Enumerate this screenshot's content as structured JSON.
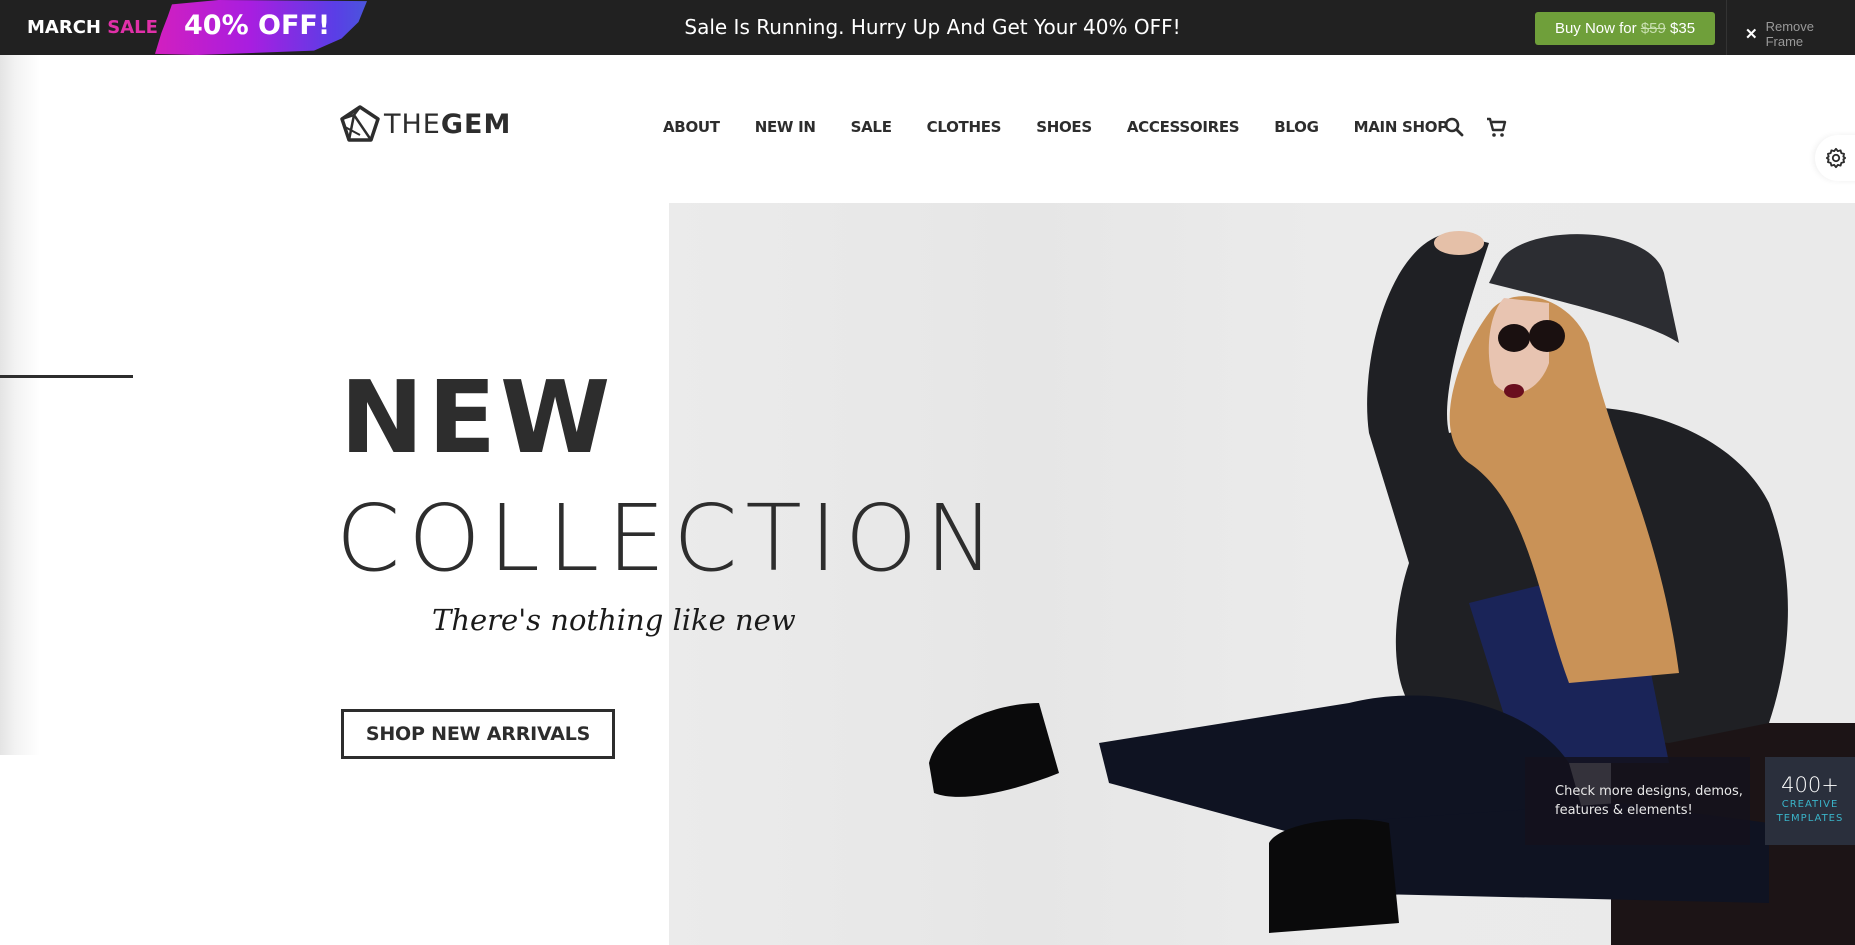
{
  "promo_bar": {
    "march": "MARCH",
    "sale": "SALE",
    "discount": "40% OFF!",
    "message": "Sale Is Running. Hurry Up And Get Your 40% OFF!",
    "buy_prefix": "Buy Now for",
    "old_price": "$59",
    "new_price": "$35",
    "remove_frame": "Remove Frame",
    "colors": {
      "background": "#212121",
      "accent_pink": "#e030a8",
      "buy_green": "#6f9f3a"
    }
  },
  "header": {
    "logo": {
      "the": "THE",
      "gem": "GEM"
    },
    "nav": [
      "ABOUT",
      "NEW IN",
      "SALE",
      "CLOTHES",
      "SHOES",
      "ACCESSOIRES",
      "BLOG",
      "MAIN SHOP"
    ],
    "icons": [
      "search-icon",
      "cart-icon"
    ],
    "settings_icon": "gear-icon"
  },
  "hero": {
    "title_line1": "NEW",
    "title_line2": "COLLECTION",
    "tagline": "There's nothing like new",
    "cta": "SHOP NEW ARRIVALS",
    "image_alt": "Model in black leather jacket, hat and sunglasses sitting on floor"
  },
  "templates_promo": {
    "message_line1": "Check more designs, demos,",
    "message_line2": "features & elements!",
    "count": "400+",
    "label_line1": "CREATIVE",
    "label_line2": "TEMPLATES"
  }
}
